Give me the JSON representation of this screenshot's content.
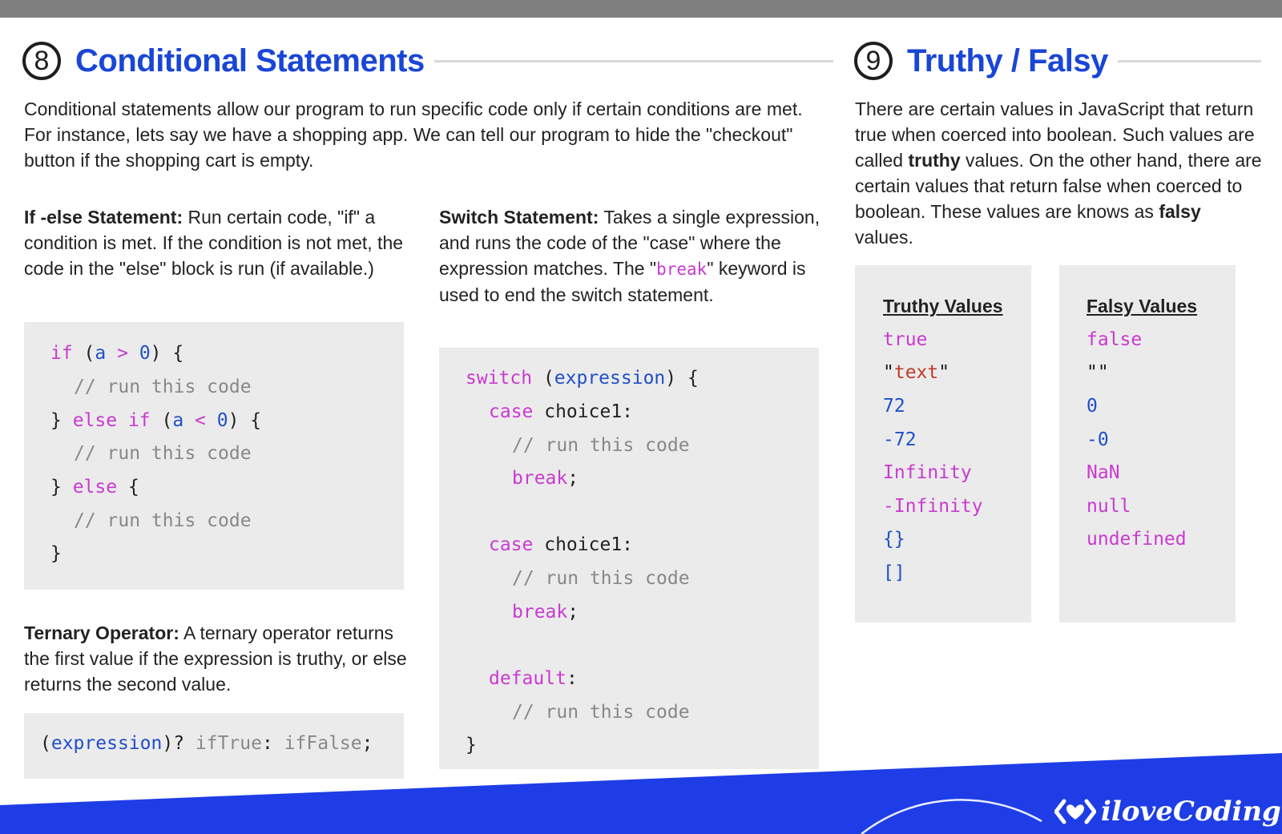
{
  "section8": {
    "number": "8",
    "title": "Conditional Statements",
    "intro": "Conditional statements allow our program to run specific code only if certain conditions are met. For instance, lets say we have a shopping app. We can tell our program to hide the \"checkout\" button if the shopping cart is empty.",
    "ifelse": {
      "label": "If -else Statement:",
      "text": " Run certain code, \"if\" a condition is met. If the condition is not met, the code in the \"else\" block is run (if available.)"
    },
    "switch": {
      "label": "Switch Statement:",
      "text_before": " Takes a single expression, and runs the code of the \"case\" where the expression matches. The \"",
      "keyword": "break",
      "text_after": "\" keyword is used to end the switch statement."
    },
    "ternary": {
      "label": "Ternary Operator:",
      "text": " A ternary operator returns the first value if the expression is truthy, or else returns the second value."
    },
    "code_if": {
      "kw_if": "if",
      "open_paren": " (",
      "var_a": "a",
      "gt": " > ",
      "zero": "0",
      "close_brace_open": ") {",
      "comment": "// run this code",
      "close_brace": "} ",
      "kw_else_if": "else if",
      "lt": " < ",
      "kw_else": "else",
      "open_brace": " {",
      "end_brace": "}"
    },
    "code_switch": {
      "kw_switch": "switch",
      "open_paren": " (",
      "expression": "expression",
      "close": ") {",
      "kw_case": "case",
      "choice": " choice1:",
      "comment": "// run this code",
      "kw_break": "break",
      "semicolon": ";",
      "kw_default": "default",
      "colon": ":",
      "end_brace": "}"
    },
    "code_ternary": {
      "open": "(",
      "expression": "expression",
      "close_q": ")? ",
      "if_true": "ifTrue",
      "colon": ": ",
      "if_false": "ifFalse",
      "semicolon": ";"
    }
  },
  "section9": {
    "number": "9",
    "title": "Truthy / Falsy",
    "intro_1": "There are certain values in JavaScript that return true when coerced into boolean. Such values are called ",
    "truthy_word": "truthy",
    "intro_2": " values. On the other hand, there are certain values that return false when coerced to boolean. These values are knows as ",
    "falsy_word": "falsy",
    "intro_3": " values.",
    "truthy_header": "Truthy Values",
    "truthy_values": [
      "true",
      "\"text\"",
      "72",
      "-72",
      "Infinity",
      "-Infinity",
      "{}",
      "[]"
    ],
    "falsy_header": "Falsy Values",
    "falsy_values": [
      "false",
      "\"\"",
      "0",
      "-0",
      "NaN",
      "null",
      "undefined"
    ]
  },
  "footer": {
    "brand": "iloveCoding"
  },
  "colors": {
    "title_blue": "#1a46d6",
    "keyword_magenta": "#c93ad0",
    "value_blue": "#1f4fc8",
    "string_red": "#c0392b",
    "comment_gray": "#888888",
    "footer_blue": "#1f3de6",
    "code_bg": "#ebebeb"
  },
  "icons": [
    "number-8-badge",
    "number-9-badge",
    "ilovecoding-logo-icon"
  ]
}
